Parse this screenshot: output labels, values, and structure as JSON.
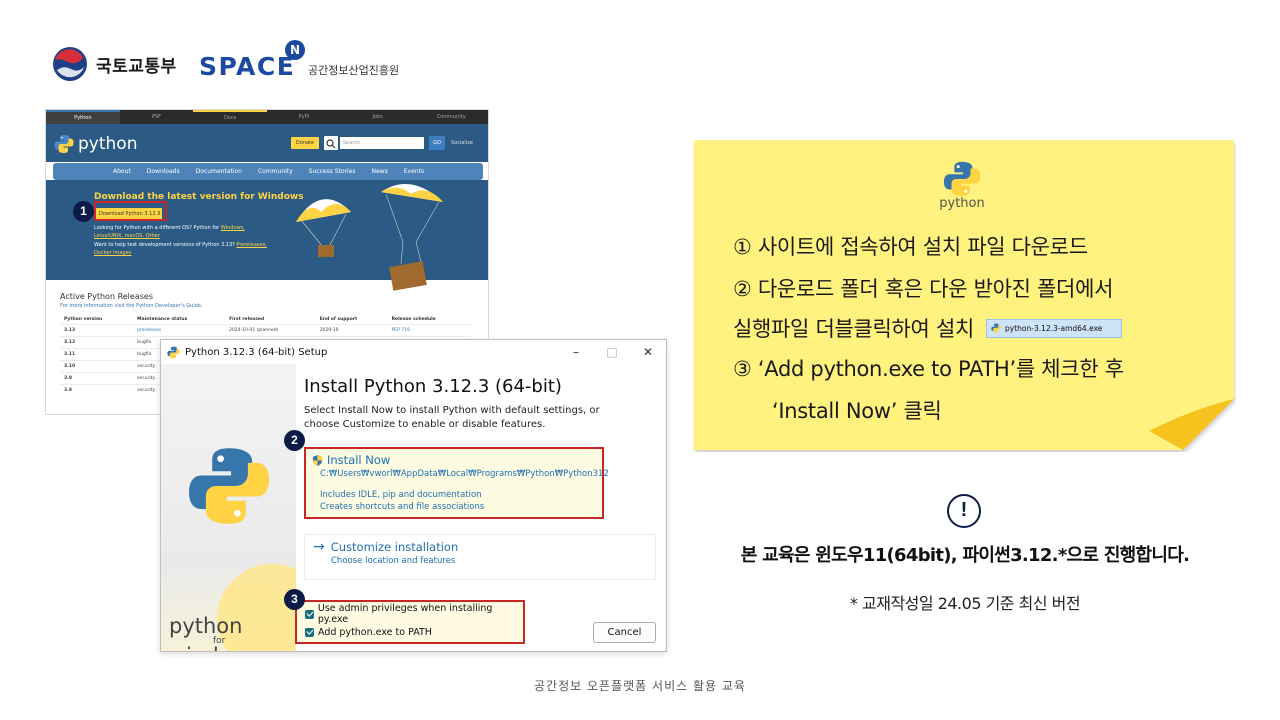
{
  "header": {
    "ministry_name": "국토교통부",
    "space_logo_text": "SPACE",
    "space_logo_badge": "N",
    "space_org_name": "공간정보산업진흥원"
  },
  "website": {
    "top_nav": [
      "Python",
      "PSF",
      "Docs",
      "PyPI",
      "Jobs",
      "Community"
    ],
    "logo_text": "python",
    "donate_label": "Donate",
    "search_placeholder": "Search",
    "go_label": "GO",
    "socialize_label": "Socialize",
    "main_nav": [
      "About",
      "Downloads",
      "Documentation",
      "Community",
      "Success Stories",
      "News",
      "Events"
    ],
    "hero_title": "Download the latest version for Windows",
    "download_button": "Download Python 3.12.3",
    "hero_line1_prefix": "Looking for Python with a different OS? Python for ",
    "hero_line1_link": "Windows,",
    "hero_line2": "Linux/UNIX, macOS, Other",
    "hero_line3_prefix": "Want to help test development versions of Python 3.13? ",
    "hero_line3_link": "Prereleases,",
    "hero_line4": "Docker images",
    "releases_title": "Active Python Releases",
    "releases_subtitle": "For more information visit the Python Developer's Guide.",
    "table_headers": [
      "Python version",
      "Maintenance status",
      "First released",
      "End of support",
      "Release schedule"
    ],
    "table_rows": [
      [
        "3.13",
        "prerelease",
        "2024-10-01 (planned)",
        "2029-10",
        "PEP 719"
      ],
      [
        "3.12",
        "bugfix",
        "",
        "",
        ""
      ],
      [
        "3.11",
        "bugfix",
        "",
        "",
        ""
      ],
      [
        "3.10",
        "security",
        "",
        "",
        ""
      ],
      [
        "3.9",
        "security",
        "",
        "",
        ""
      ],
      [
        "3.8",
        "security",
        "",
        "",
        ""
      ]
    ]
  },
  "installer": {
    "window_title": "Python 3.12.3 (64-bit) Setup",
    "minimize": "–",
    "maximize": "□",
    "close": "✕",
    "heading": "Install Python 3.12.3 (64-bit)",
    "description": "Select Install Now to install Python with default settings, or choose Customize to enable or disable features.",
    "install_now_title": "Install Now",
    "install_now_path": "C:₩Users₩vworl₩AppData₩Local₩Programs₩Python₩Python312",
    "install_now_includes": "Includes IDLE, pip and documentation",
    "install_now_shortcuts": "Creates shortcuts and file associations",
    "customize_title": "Customize installation",
    "customize_subtitle": "Choose location and features",
    "check_admin": "Use admin privileges when installing py.exe",
    "check_path": "Add python.exe to PATH",
    "cancel_label": "Cancel",
    "sidebar_python": "python",
    "sidebar_for": "for",
    "sidebar_windows": "windows"
  },
  "badges": {
    "step1": "1",
    "step2": "2",
    "step3": "3"
  },
  "note": {
    "python_word": "python",
    "line1": "① 사이트에 접속하여 설치 파일 다운로드",
    "line2": "② 다운로드 폴더 혹은 다운 받아진 폴더에서",
    "line3": "실행파일 더블클릭하여 설치",
    "exe_file": "python-3.12.3-amd64.exe",
    "line4": "③ ‘Add python.exe to PATH’를 체크한 후",
    "line5": "‘Install Now’ 클릭"
  },
  "notice": {
    "icon_glyph": "!",
    "main": "본 교육은 윈도우11(64bit), 파이썬3.12.*으로 진행합니다.",
    "sub": "* 교재작성일 24.05 기준 최신 버전"
  },
  "footer": {
    "text": "공간정보 오픈플랫폼 서비스 활용 교육"
  },
  "colors": {
    "python_blue": "#3776ab",
    "python_yellow": "#ffd343",
    "site_header": "#2b5b84",
    "highlight_red": "#c62828",
    "badge_navy": "#0c1b48",
    "note_yellow": "#fff27e",
    "link_blue": "#1f6fb2"
  }
}
